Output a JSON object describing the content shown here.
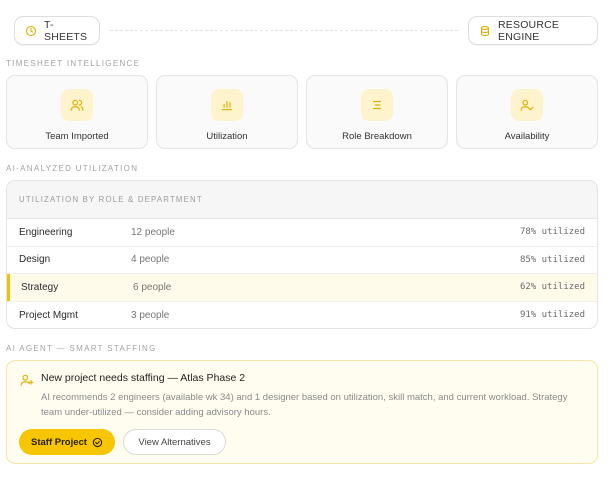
{
  "header": {
    "left_pill": "T-SHEETS",
    "right_pill": "RESOURCE ENGINE"
  },
  "sections": {
    "timesheet": "TIMESHEET INTELLIGENCE",
    "utilization": "AI-ANALYZED UTILIZATION",
    "agent": "AI AGENT — SMART STAFFING"
  },
  "cards": [
    {
      "label": "Team Imported",
      "icon": "users-icon"
    },
    {
      "label": "Utilization",
      "icon": "bar-chart-icon"
    },
    {
      "label": "Role Breakdown",
      "icon": "list-icon"
    },
    {
      "label": "Availability",
      "icon": "user-check-icon"
    }
  ],
  "table": {
    "heading": "UTILIZATION BY ROLE & DEPARTMENT",
    "rows": [
      {
        "role": "Engineering",
        "people": "12 people",
        "util": "78% utilized"
      },
      {
        "role": "Design",
        "people": "4 people",
        "util": "85% utilized"
      },
      {
        "role": "Strategy",
        "people": "6 people",
        "util": "62% utilized"
      },
      {
        "role": "Project Mgmt",
        "people": "3 people",
        "util": "91% utilized"
      }
    ]
  },
  "agent": {
    "title": "New project needs staffing — Atlas Phase 2",
    "description": "AI recommends 2 engineers (available wk 34) and 1 designer based on utilization, skill match, and current workload. Strategy team under-utilized — consider adding advisory hours.",
    "primary_button": "Staff Project",
    "secondary_button": "View Alternatives"
  },
  "colors": {
    "accent": "#f7c600",
    "accent_soft": "#fdf3cc",
    "highlight_row": "#fffbea"
  }
}
